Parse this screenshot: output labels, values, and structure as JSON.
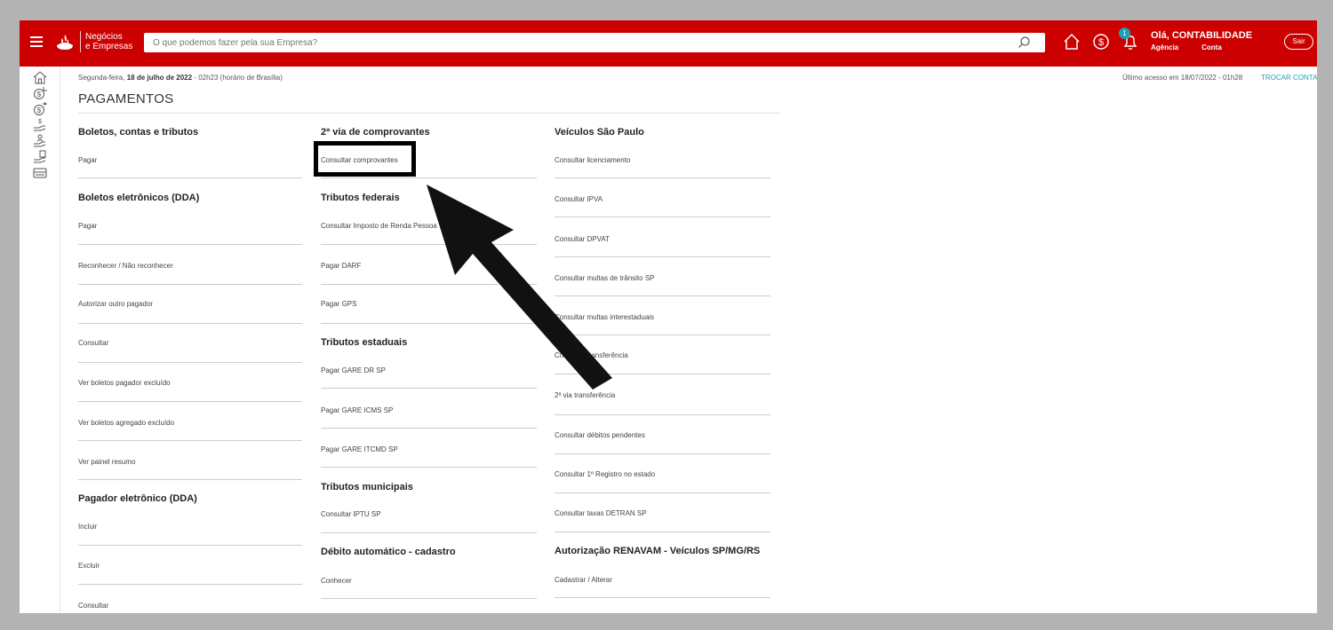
{
  "header": {
    "brand_line1": "Negócios",
    "brand_line2": "e Empresas",
    "search_placeholder": "O que podemos fazer pela sua Empresa?",
    "notification_count": "1",
    "greeting": "Olá, CONTABILIDADE",
    "agency_label": "Agência",
    "account_label": "Conta",
    "logout_label": "Sair",
    "brand_color": "#cc0000"
  },
  "rail": {
    "icons": [
      "home-icon",
      "money-refresh-icon",
      "money-transfer-icon",
      "hand-coin-icon",
      "hand-person-icon",
      "hand-doc-icon",
      "card-icon"
    ]
  },
  "meta": {
    "date_prefix": "Segunda-feira, ",
    "date_bold": "18 de julho de 2022",
    "date_suffix": " - 02h23 (horário de Brasília)",
    "last_access": "Último acesso em 18/07/2022 - 01h28",
    "switch_account": "TROCAR CONTA"
  },
  "page": {
    "title": "PAGAMENTOS"
  },
  "columns": {
    "col1": {
      "boletos_title": "Boletos, contas e tributos",
      "boletos_items": [
        "Pagar"
      ],
      "dda_title": "Boletos eletrônicos (DDA)",
      "dda_items": [
        "Pagar",
        "Reconhecer / Não reconhecer",
        "Autorizar outro pagador",
        "Consultar",
        "Ver boletos pagador excluído",
        "Ver boletos agregado excluído",
        "Ver painel resumo"
      ],
      "pagador_title": "Pagador eletrônico (DDA)",
      "pagador_items": [
        "Incluir",
        "Excluir",
        "Consultar"
      ]
    },
    "col2": {
      "vias_title": "2ª via de comprovantes",
      "vias_items": [
        "Consultar comprovantes"
      ],
      "federais_title": "Tributos federais",
      "federais_items": [
        "Consultar Imposto de Renda Pessoa",
        "Pagar DARF",
        "Pagar GPS"
      ],
      "estaduais_title": "Tributos estaduais",
      "estaduais_items": [
        "Pagar GARE DR SP",
        "Pagar GARE ICMS SP",
        "Pagar GARE ITCMD SP"
      ],
      "municipais_title": "Tributos municipais",
      "municipais_items": [
        "Consultar IPTU SP"
      ],
      "debito_title": "Débito automático - cadastro",
      "debito_items": [
        "Conhecer"
      ]
    },
    "col3": {
      "sp_title": "Veículos São Paulo",
      "sp_items": [
        "Consultar licenciamento",
        "Consultar IPVA",
        "Consultar DPVAT",
        "Consultar multas de trânsito SP",
        "Consultar multas interestaduais",
        "Consultar transferência",
        "2ª via transferência",
        "Consultar débitos pendentes",
        "Consultar 1º Registro no estado",
        "Consultar taxas DETRAN SP"
      ],
      "renavam_title": "Autorização RENAVAM - Veículos SP/MG/RS",
      "renavam_items": [
        "Cadastrar / Alterar"
      ]
    }
  }
}
